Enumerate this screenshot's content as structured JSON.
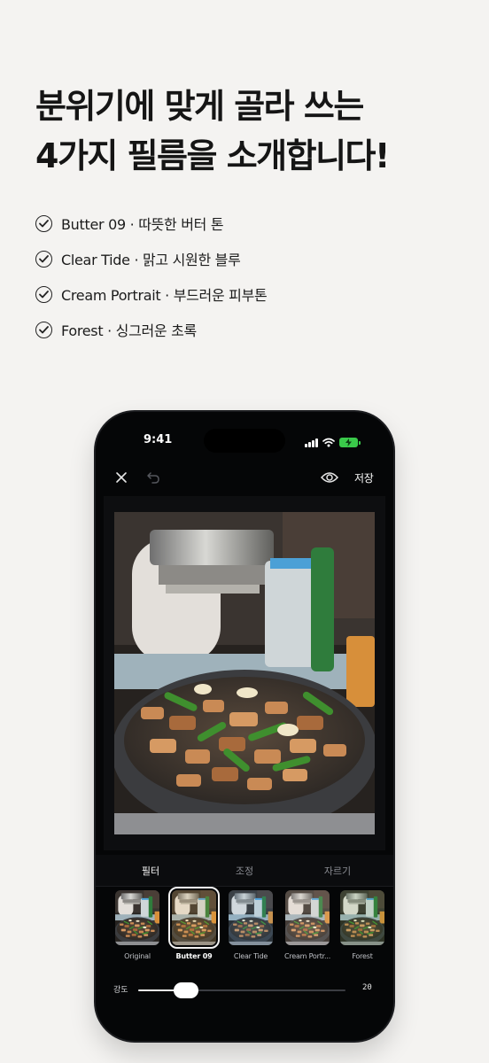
{
  "headline": {
    "line1": "분위기에 맞게 골라 쓰는",
    "line2": "4가지 필름을 소개합니다!"
  },
  "features": [
    {
      "text": "Butter 09 · 따뜻한 버터 톤"
    },
    {
      "text": "Clear Tide · 맑고 시원한 블루"
    },
    {
      "text": "Cream Portrait · 부드러운 피부톤"
    },
    {
      "text": "Forest · 싱그러운 초록"
    }
  ],
  "phone": {
    "status": {
      "time": "9:41",
      "battery_color": "#3ac94a"
    },
    "toolbar": {
      "save_label": "저장"
    },
    "tabs": [
      {
        "label": "필터",
        "active": true
      },
      {
        "label": "조정",
        "active": false
      },
      {
        "label": "자르기",
        "active": false
      }
    ],
    "filters": [
      {
        "label": "Original",
        "selected": false
      },
      {
        "label": "Butter 09",
        "selected": true
      },
      {
        "label": "Clear Tide",
        "selected": false
      },
      {
        "label": "Cream Portr...",
        "selected": false
      },
      {
        "label": "Forest",
        "selected": false
      }
    ],
    "intensity": {
      "label": "강도",
      "value": "20",
      "level_percent": 23
    }
  },
  "colors": {
    "background": "#f4f3f1",
    "phone_body": "#050607",
    "accent_white": "#ffffff"
  }
}
